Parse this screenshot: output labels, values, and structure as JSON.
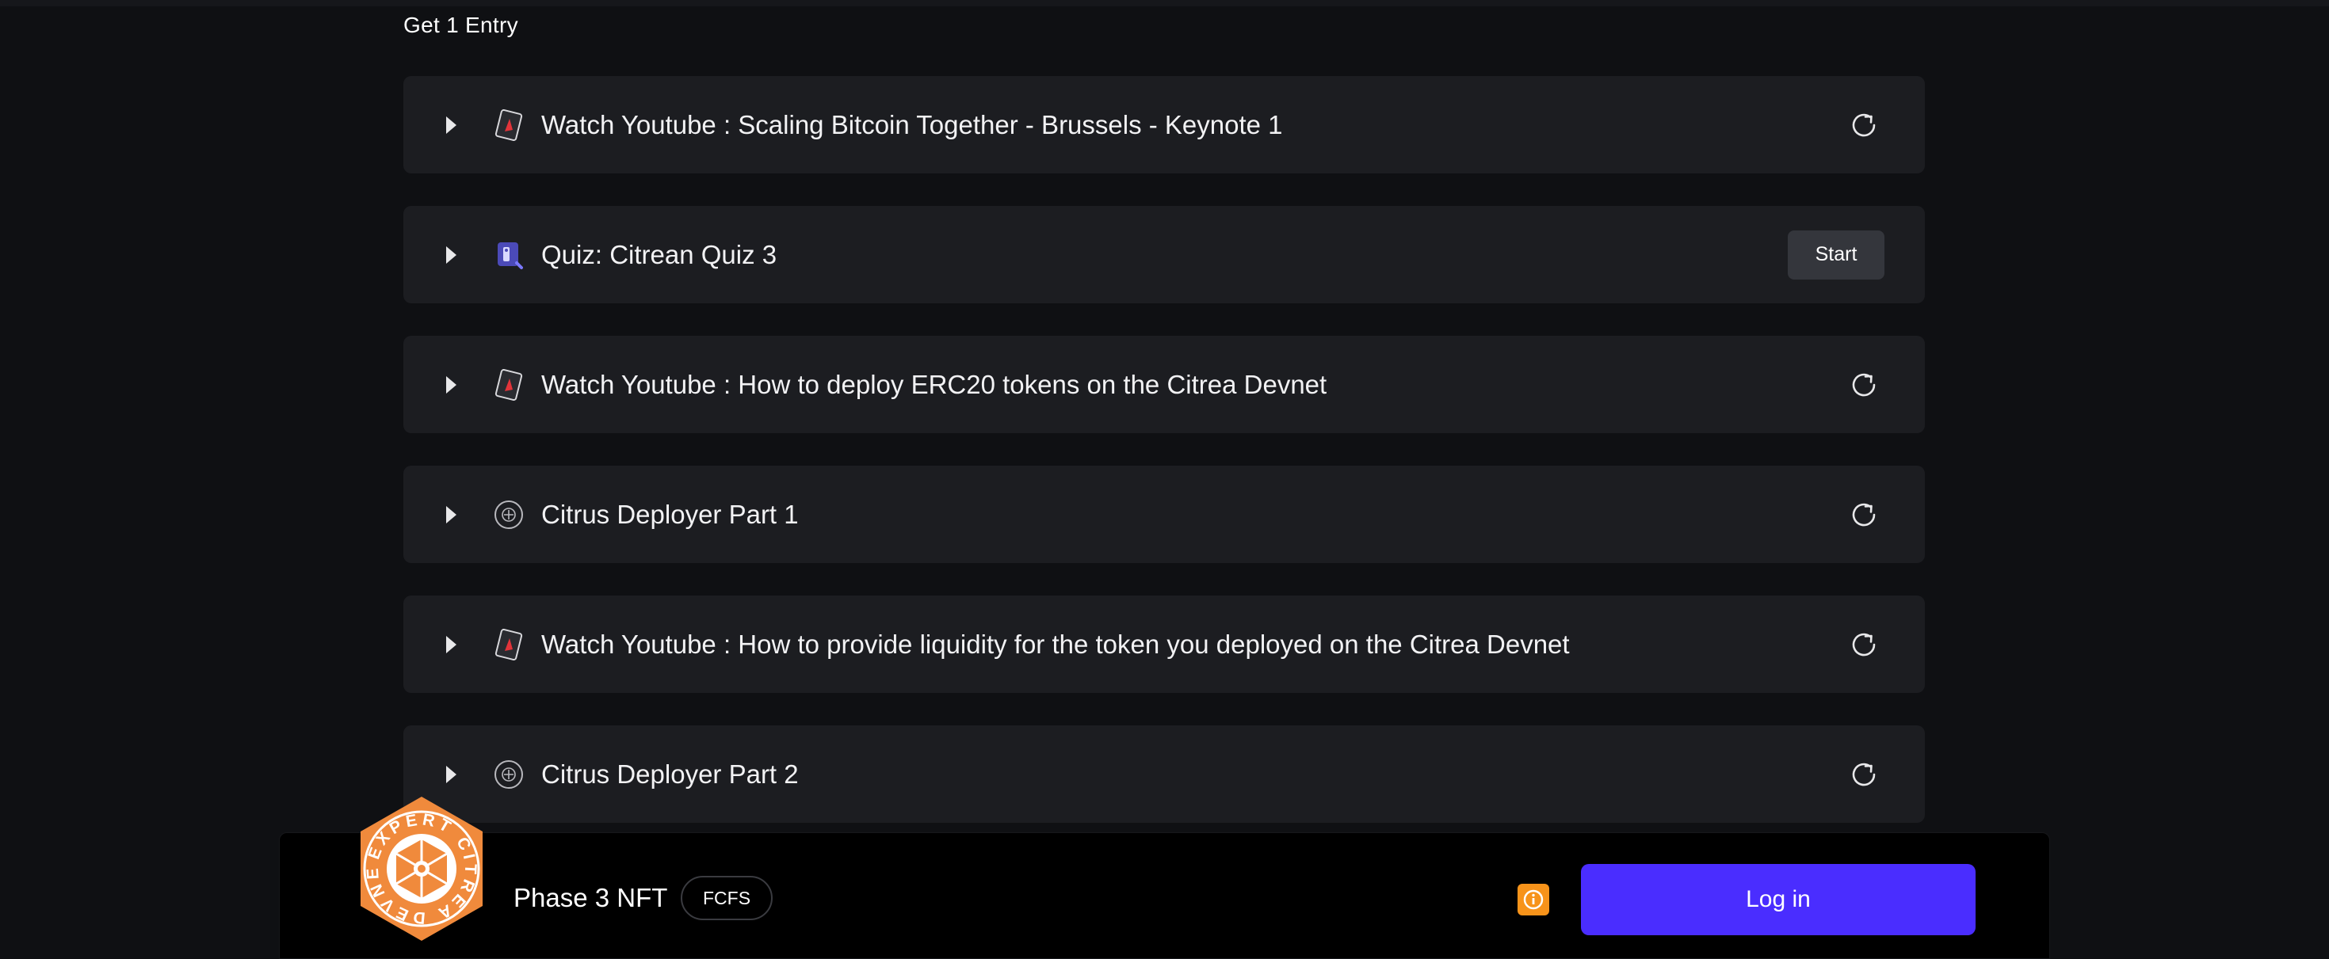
{
  "section": {
    "title": "Get 1 Entry"
  },
  "tasks": [
    {
      "label": "Watch Youtube : Scaling Bitcoin Together - Brussels - Keynote 1",
      "icon": "youtube-card-icon",
      "action": "refresh"
    },
    {
      "label": "Quiz: Citrean Quiz 3",
      "icon": "quiz-icon",
      "action": "start",
      "action_label": "Start"
    },
    {
      "label": "Watch Youtube : How to deploy ERC20 tokens on the Citrea Devnet",
      "icon": "youtube-card-icon",
      "action": "refresh"
    },
    {
      "label": "Citrus Deployer Part 1",
      "icon": "plus-circle-icon",
      "action": "refresh"
    },
    {
      "label": "Watch Youtube : How to provide liquidity for the token you deployed on the Citrea Devnet",
      "icon": "youtube-card-icon",
      "action": "refresh"
    },
    {
      "label": "Citrus Deployer Part 2",
      "icon": "plus-circle-icon",
      "action": "refresh"
    }
  ],
  "bottom_bar": {
    "badge_text": "EXPERT CITREA DEVNET",
    "nft_name": "Phase 3 NFT",
    "tag": "FCFS",
    "login_label": "Log in",
    "info_icon": "info-icon"
  },
  "colors": {
    "background": "#0f1013",
    "card": "#1c1d21",
    "accent": "#4a2dff",
    "badge_orange": "#f08a3c",
    "info_orange": "#f7931a"
  }
}
